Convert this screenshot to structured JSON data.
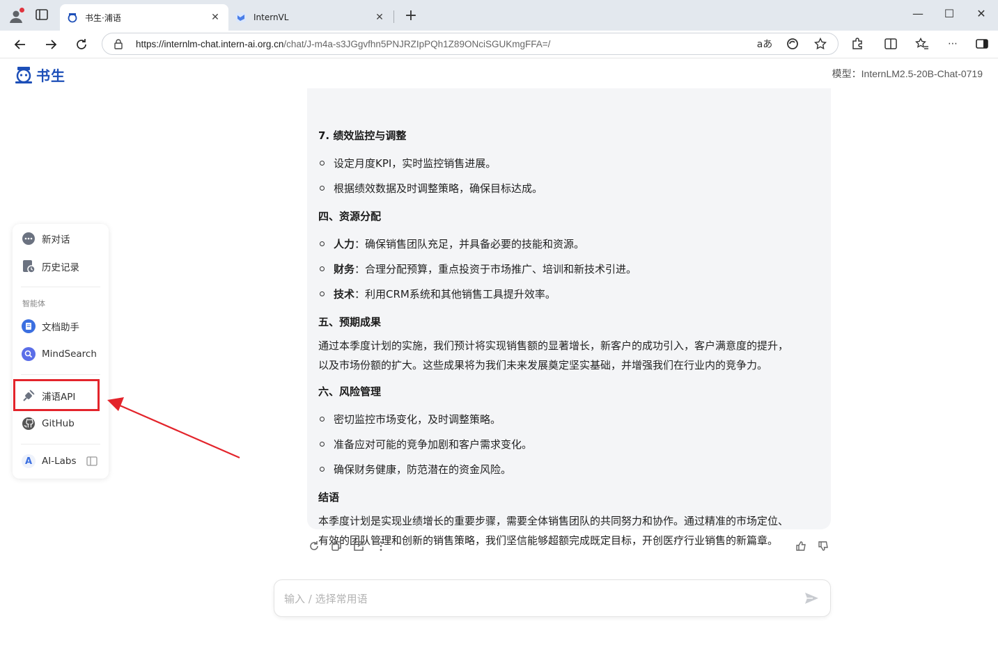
{
  "browser": {
    "tabs": [
      {
        "title": "书生·浦语",
        "active": true
      },
      {
        "title": "InternVL",
        "active": false
      }
    ],
    "url_host": "https://internlm-chat.intern-ai.org.cn",
    "url_path": "/chat/J-m4a-s3JGgvfhn5PNJRZIpPQh1Z89ONciSGUKmgFFA=/",
    "read_aloud_label": "aあ"
  },
  "header": {
    "logo_text": "书生",
    "model_label": "模型：InternLM2.5-20B-Chat-0719"
  },
  "sidebar": {
    "new_chat": "新对话",
    "history": "历史记录",
    "section_label": "智能体",
    "doc_assistant": "文档助手",
    "mindsearch": "MindSearch",
    "puyu_api": "浦语API",
    "github": "GitHub",
    "ai_labs": "AI-Labs",
    "ai_labs_badge": "A"
  },
  "message": {
    "h7": "7. 绩效监控与调整",
    "li7_1": "设定月度KPI，实时监控销售进展。",
    "li7_2": "根据绩效数据及时调整策略，确保目标达成。",
    "h4": "四、资源分配",
    "li4_1_b": "人力",
    "li4_1": "：确保销售团队充足，并具备必要的技能和资源。",
    "li4_2_b": "财务",
    "li4_2": "：合理分配预算，重点投资于市场推广、培训和新技术引进。",
    "li4_3_b": "技术",
    "li4_3": "：利用CRM系统和其他销售工具提升效率。",
    "h5": "五、预期成果",
    "p5_1": "通过本季度计划的实施，我们预计将实现销售额的显著增长，新客户的成功引入，客户满意度的提升，",
    "p5_2": "以及市场份额的扩大。这些成果将为我们未来发展奠定坚实基础，并增强我们在行业内的竞争力。",
    "h6": "六、风险管理",
    "li6_1": "密切监控市场变化，及时调整策略。",
    "li6_2": "准备应对可能的竞争加剧和客户需求变化。",
    "li6_3": "确保财务健康，防范潜在的资金风险。",
    "h_end": "结语",
    "p_end_1": "本季度计划是实现业绩增长的重要步骤，需要全体销售团队的共同努力和协作。通过精准的市场定位、",
    "p_end_2": "有效的团队管理和创新的销售策略，我们坚信能够超额完成既定目标，开创医疗行业销售的新篇章。"
  },
  "input": {
    "placeholder": "输入 / 选择常用语"
  },
  "colors": {
    "brand": "#1d4fb8",
    "highlight": "#e3242b",
    "card_bg": "#f4f5f7"
  }
}
